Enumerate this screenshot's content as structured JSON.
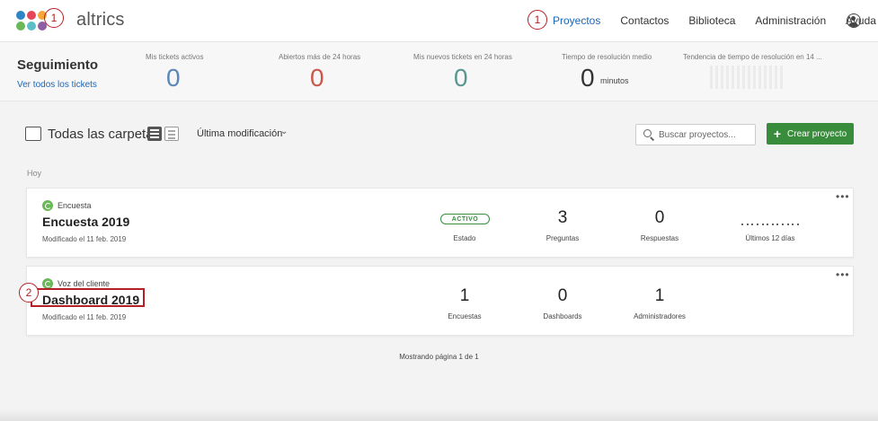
{
  "brand": {
    "logo_text": "altrics",
    "dot_colors": [
      "#2e85c5",
      "#e4455b",
      "#f6a63a",
      "#6bb85a",
      "#59c0c8",
      "#8e5ea2"
    ]
  },
  "annotations": {
    "marker_1": "1",
    "marker_2": "2",
    "marker_color": "#b32025"
  },
  "nav": {
    "items": [
      {
        "label": "Proyectos",
        "active": true
      },
      {
        "label": "Contactos"
      },
      {
        "label": "Biblioteca"
      },
      {
        "label": "Administración"
      },
      {
        "label": "Ayuda"
      }
    ],
    "user_icon": "user-circle-icon"
  },
  "stats": {
    "title": "Seguimiento",
    "link": "Ver todos los tickets",
    "items": [
      {
        "label": "Mis tickets activos",
        "value": "0",
        "color": "#5a87b8"
      },
      {
        "label": "Abiertos más de 24 horas",
        "value": "0",
        "color": "#c9574a"
      },
      {
        "label": "Mis nuevos tickets en 24 horas",
        "value": "0",
        "color": "#5a9690"
      },
      {
        "label": "Tiempo de resolución medio",
        "value": "0",
        "unit": "minutos",
        "color": "#333333"
      },
      {
        "label": "Tendencia de tiempo de resolución en 14 ..."
      }
    ]
  },
  "toolbar": {
    "folder_label": "Todas las carpetas",
    "sort_label": "Última modificación",
    "search_placeholder": "Buscar proyectos...",
    "create_label": "Crear proyecto",
    "accent": "#3a8c3d"
  },
  "section_label": "Hoy",
  "projects": [
    {
      "type": "Encuesta",
      "title": "Encuesta 2019",
      "modified": "Modificado el 11 feb. 2019",
      "status": "ACTIVO",
      "status_label": "Estado",
      "metrics": [
        {
          "value": "3",
          "label": "Preguntas"
        },
        {
          "value": "0",
          "label": "Respuestas"
        }
      ],
      "trend_label": "Últimos 12 días"
    },
    {
      "type": "Voz del cliente",
      "title": "Dashboard 2019",
      "modified": "Modificado el 11 feb. 2019",
      "metrics": [
        {
          "value": "1",
          "label": "Encuestas"
        },
        {
          "value": "0",
          "label": "Dashboards"
        },
        {
          "value": "1",
          "label": "Administradores"
        }
      ]
    }
  ],
  "pagination": "Mostrando página 1 de 1"
}
